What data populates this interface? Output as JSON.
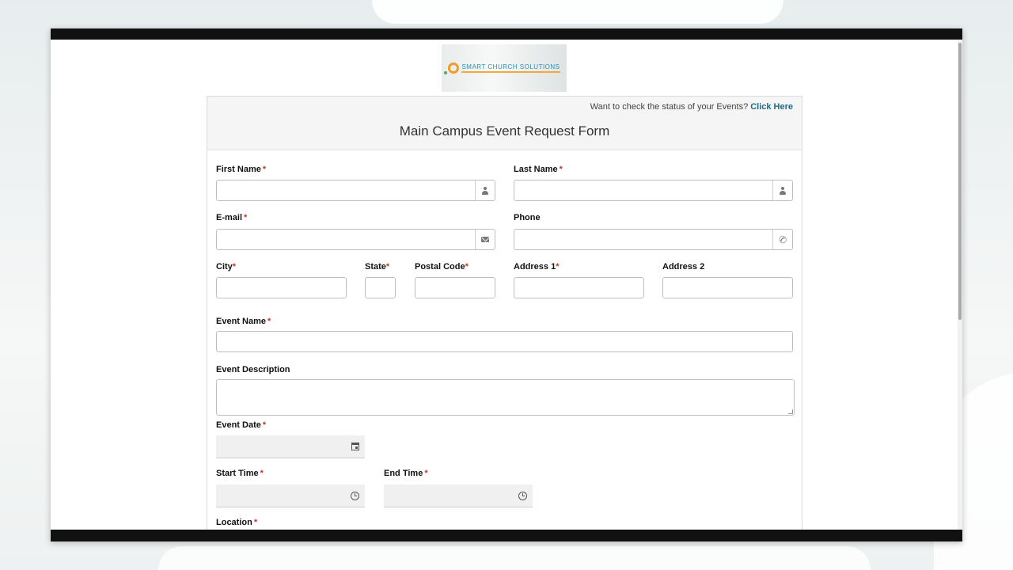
{
  "logo": {
    "brand_text": "SMART CHURCH SOLUTIONS"
  },
  "header": {
    "status_prompt": "Want to check the status of your Events?",
    "status_link": "Click Here",
    "title": "Main Campus Event Request Form"
  },
  "fields": {
    "first_name": {
      "label": "First Name",
      "required": "*",
      "icon": "person-icon"
    },
    "last_name": {
      "label": "Last Name",
      "required": "*",
      "icon": "person-icon"
    },
    "email": {
      "label": "E-mail",
      "required": "*",
      "icon": "envelope-icon"
    },
    "phone": {
      "label": "Phone",
      "icon": "phone-icon"
    },
    "city": {
      "label": "City",
      "required": "*"
    },
    "state": {
      "label": "State",
      "required": "*"
    },
    "postal_code": {
      "label": "Postal Code",
      "required": "*"
    },
    "address1": {
      "label": "Address 1",
      "required": "*"
    },
    "address2": {
      "label": "Address 2"
    },
    "event_name": {
      "label": "Event Name",
      "required": "*"
    },
    "event_description": {
      "label": "Event Description"
    },
    "event_date": {
      "label": "Event Date",
      "required": "*",
      "icon": "calendar-icon"
    },
    "start_time": {
      "label": "Start Time",
      "required": "*",
      "icon": "clock-icon"
    },
    "end_time": {
      "label": "End Time",
      "required": "*",
      "icon": "clock-icon"
    },
    "location": {
      "label": "Location",
      "required": "*"
    }
  },
  "colors": {
    "required": "#c0392b",
    "link": "#1f6a8c",
    "header_bg": "#f5f5f5",
    "frame": "#111111"
  }
}
